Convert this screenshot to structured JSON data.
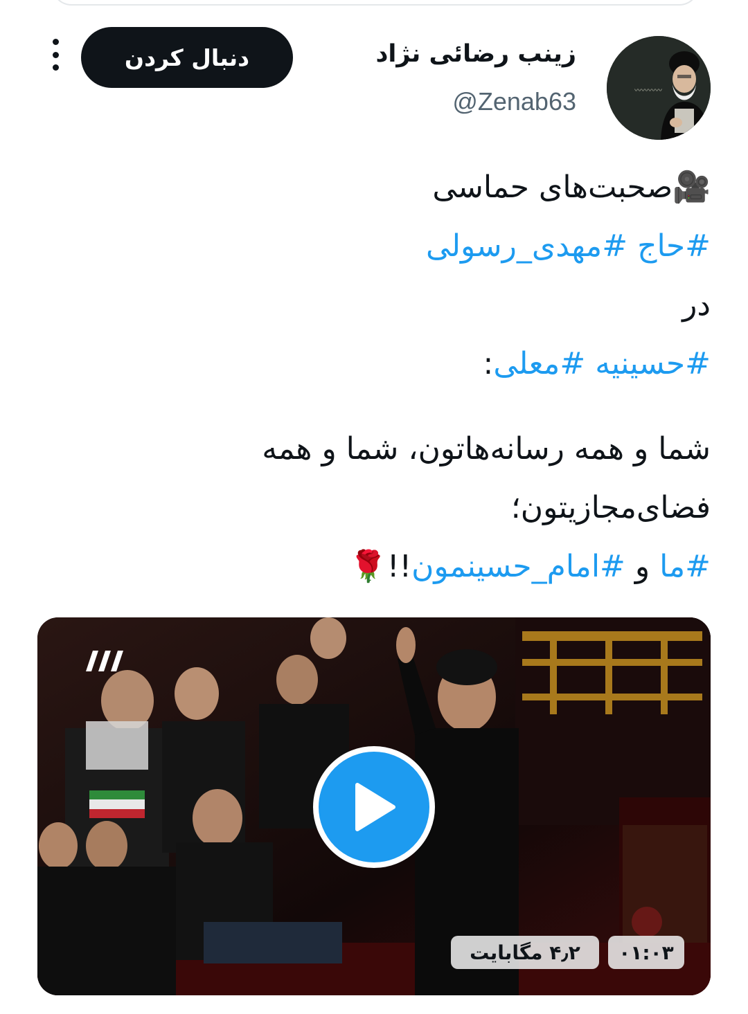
{
  "tweet": {
    "author": {
      "name": "زینب رضائی نژاد",
      "handle": "@Zenab63",
      "avatar": "avatar-portrait-image"
    },
    "follow_label": "دنبال کردن",
    "more_icon": "more-options-icon",
    "lines": [
      {
        "emoji": "🎥",
        "text": "صحبت‌های حماسی"
      },
      {
        "hashtags": [
          "#حاج",
          "#مهدی_رسولی"
        ]
      },
      {
        "text": "در"
      },
      {
        "hashtags": [
          "#حسینیه",
          "#معلی"
        ],
        "suffix": ":"
      },
      {
        "text": "شما و همه رسانه‌هاتون، شما و همه"
      },
      {
        "text": "فضای‌مجازیتون؛"
      },
      {
        "hashtag_1": "#ما",
        "joiner": "و",
        "hashtag_2": "#امام_حسینمون",
        "suffix": "!!",
        "emoji": "🌹"
      }
    ],
    "media": {
      "type": "video",
      "play_icon": "play-icon",
      "file_size": "۴٫۲ مگابایت",
      "duration": "۰۱:۰۳",
      "channel_logo": "tv3-logo-icon"
    }
  },
  "colors": {
    "link": "#1d9bf0",
    "text": "#0f1419",
    "secondary": "#536471",
    "button_bg": "#0f1419"
  }
}
